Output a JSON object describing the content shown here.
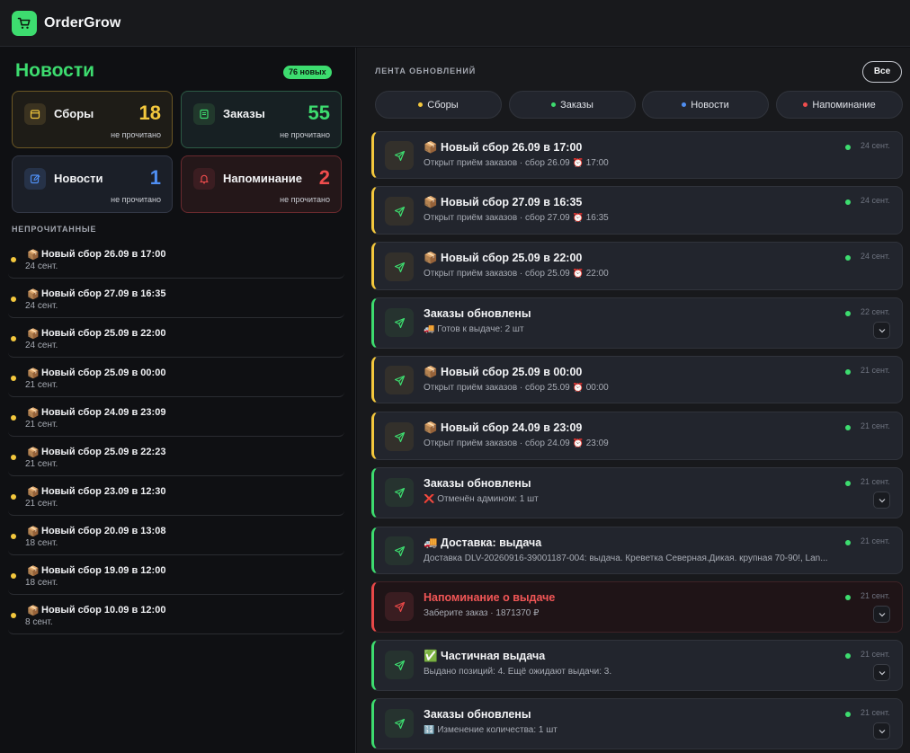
{
  "app": {
    "name": "OrderGrow"
  },
  "news": {
    "title": "Новости",
    "badge": "76 новых",
    "stats": [
      {
        "label": "Сборы",
        "value": "18",
        "sub": "не прочитано"
      },
      {
        "label": "Заказы",
        "value": "55",
        "sub": "не прочитано"
      },
      {
        "label": "Новости",
        "value": "1",
        "sub": "не прочитано"
      },
      {
        "label": "Напоминание",
        "value": "2",
        "sub": "не прочитано"
      }
    ],
    "unread_title": "НЕПРОЧИТАННЫЕ",
    "unread": [
      {
        "icon": "📦",
        "title": "Новый сбор 26.09 в 17:00",
        "date": "24 сент."
      },
      {
        "icon": "📦",
        "title": "Новый сбор 27.09 в 16:35",
        "date": "24 сент."
      },
      {
        "icon": "📦",
        "title": "Новый сбор 25.09 в 22:00",
        "date": "24 сент."
      },
      {
        "icon": "📦",
        "title": "Новый сбор 25.09 в 00:00",
        "date": "21 сент."
      },
      {
        "icon": "📦",
        "title": "Новый сбор 24.09 в 23:09",
        "date": "21 сент."
      },
      {
        "icon": "📦",
        "title": "Новый сбор 25.09 в 22:23",
        "date": "21 сент."
      },
      {
        "icon": "📦",
        "title": "Новый сбор 23.09 в 12:30",
        "date": "21 сент."
      },
      {
        "icon": "📦",
        "title": "Новый сбор 20.09 в 13:08",
        "date": "18 сент."
      },
      {
        "icon": "📦",
        "title": "Новый сбор 19.09 в 12:00",
        "date": "18 сент."
      },
      {
        "icon": "📦",
        "title": "Новый сбор 10.09 в 12:00",
        "date": "8 сент."
      }
    ]
  },
  "feed": {
    "title": "ЛЕНТА ОБНОВЛЕНИЙ",
    "all_button": "Все",
    "filters": [
      {
        "label": "Сборы",
        "color": "#f4c83d"
      },
      {
        "label": "Заказы",
        "color": "#3ddc6f"
      },
      {
        "label": "Новости",
        "color": "#4f8ef2"
      },
      {
        "label": "Напоминание",
        "color": "#f04d4d"
      }
    ],
    "items": [
      {
        "title": "📦 Новый сбор 26.09 в 17:00",
        "sub": "Открыт приём заказов · сбор 26.09 ⏰ 17:00",
        "date": "24 сент."
      },
      {
        "title": "📦 Новый сбор 27.09 в 16:35",
        "sub": "Открыт приём заказов · сбор 27.09 ⏰ 16:35",
        "date": "24 сент."
      },
      {
        "title": "📦 Новый сбор 25.09 в 22:00",
        "sub": "Открыт приём заказов · сбор 25.09 ⏰ 22:00",
        "date": "24 сент."
      },
      {
        "title": "Заказы обновлены",
        "sub": "🚚 Готов к выдаче: 2 шт",
        "date": "22 сент."
      },
      {
        "title": "📦 Новый сбор 25.09 в 00:00",
        "sub": "Открыт приём заказов · сбор 25.09 ⏰ 00:00",
        "date": "21 сент."
      },
      {
        "title": "📦 Новый сбор 24.09 в 23:09",
        "sub": "Открыт приём заказов · сбор 24.09 ⏰ 23:09",
        "date": "21 сент."
      },
      {
        "title": "Заказы обновлены",
        "sub": "❌ Отменён админом: 1 шт",
        "date": "21 сент."
      },
      {
        "title": "🚚 Доставка: выдача",
        "sub": "Доставка DLV-20260916-39001187-004: выдача. Креветка Северная.Дикая. крупная 70-90!, Lan...",
        "date": "21 сент."
      },
      {
        "title": "Напоминание о выдаче",
        "sub": "Заберите заказ · 1871370 ₽",
        "date": "21 сент."
      },
      {
        "title": "✅ Частичная выдача",
        "sub": "Выдано позиций: 4. Ещё ожидают выдачи: 3.",
        "date": "21 сент."
      },
      {
        "title": "Заказы обновлены",
        "sub": "🔢 Изменение количества: 1 шт",
        "date": "21 сент."
      }
    ]
  }
}
